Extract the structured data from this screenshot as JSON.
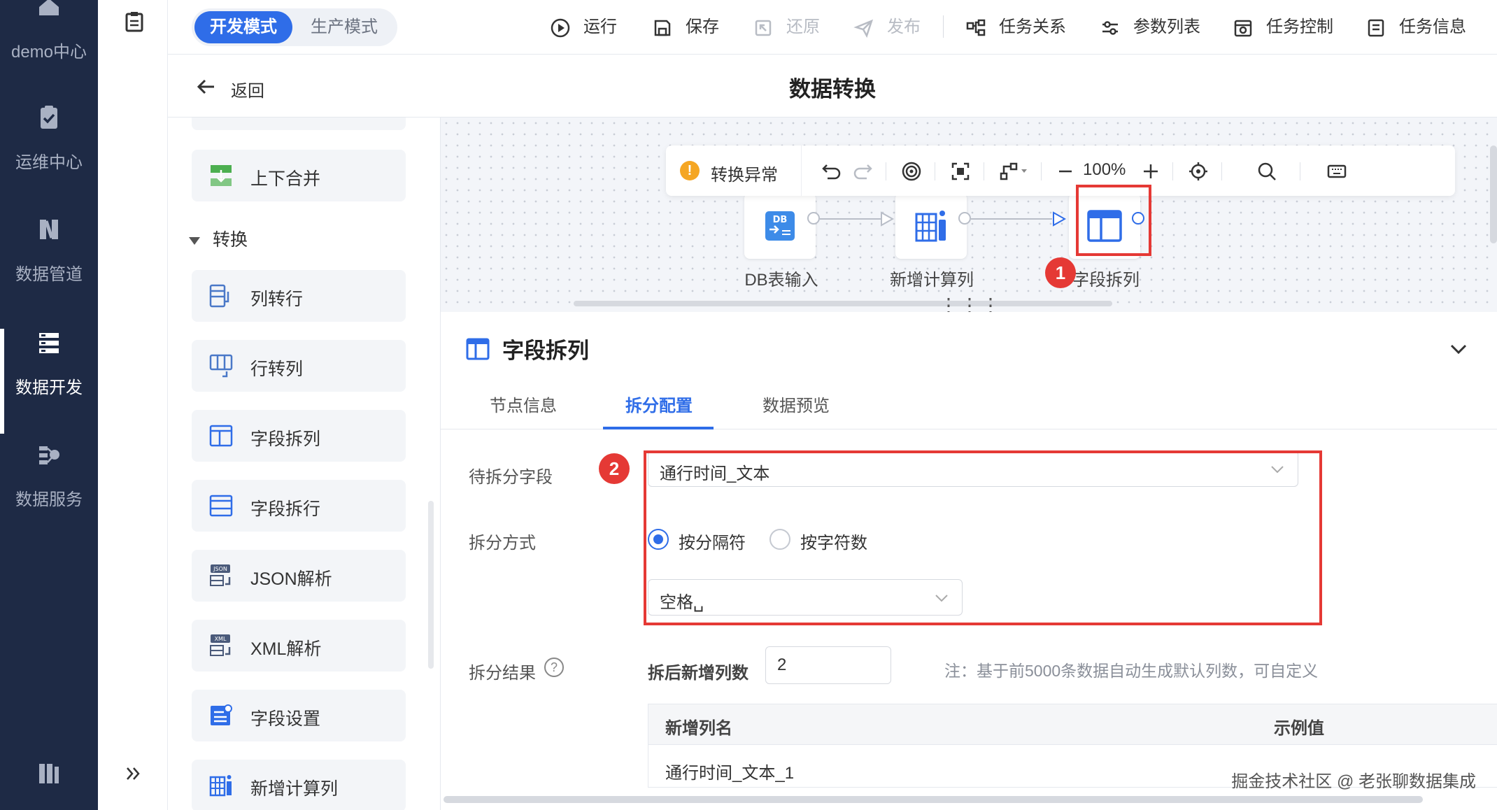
{
  "nav": {
    "items": [
      {
        "label": "demo中心",
        "icon": "home-icon"
      },
      {
        "label": "运维中心",
        "icon": "clipboard-check-icon"
      },
      {
        "label": "数据管道",
        "icon": "pipeline-icon"
      },
      {
        "label": "数据开发",
        "icon": "data-dev-icon",
        "active": true
      },
      {
        "label": "数据服务",
        "icon": "data-service-icon"
      }
    ],
    "bottom_icon": "book-icon",
    "expand_icon": "double-chevron-right-icon"
  },
  "header": {
    "mode_dev": "开发模式",
    "mode_prod": "生产模式",
    "actions": {
      "run": "运行",
      "save": "保存",
      "restore": "还原",
      "publish": "发布",
      "task_relation": "任务关系",
      "param_list": "参数列表",
      "task_control": "任务控制",
      "task_info": "任务信息"
    }
  },
  "titlebar": {
    "back": "返回",
    "title": "数据转换"
  },
  "components": {
    "top_item": "上下合并",
    "group_label": "转换",
    "items": [
      "列转行",
      "行转列",
      "字段拆列",
      "字段拆行",
      "JSON解析",
      "XML解析",
      "字段设置",
      "新增计算列"
    ]
  },
  "canvas": {
    "warning": "转换异常",
    "zoom": "100%",
    "nodes": [
      {
        "label": "DB表输入",
        "icon": "db-input-icon"
      },
      {
        "label": "新增计算列",
        "icon": "calc-column-icon"
      },
      {
        "label": "字段拆列",
        "icon": "split-column-icon"
      }
    ]
  },
  "config": {
    "title": "字段拆列",
    "tabs": [
      "节点信息",
      "拆分配置",
      "数据预览"
    ],
    "active_tab": "拆分配置",
    "field_label": "待拆分字段",
    "field_value": "通行时间_文本",
    "method_label": "拆分方式",
    "method_options": [
      "按分隔符",
      "按字符数"
    ],
    "method_selected": "按分隔符",
    "delimiter_value": "空格␣",
    "result_label": "拆分结果",
    "newcols_label": "拆后新增列数",
    "newcols_value": "2",
    "note": "注：基于前5000条数据自动生成默认列数，可自定义",
    "table": {
      "headers": [
        "新增列名",
        "示例值"
      ],
      "rows": [
        [
          "通行时间_文本_1",
          ""
        ]
      ]
    }
  },
  "annotations": {
    "badge1": "1",
    "badge2": "2"
  },
  "watermark": "掘金技术社区 @ 老张聊数据集成",
  "colors": {
    "accent": "#2f6de8",
    "nav_bg": "#1e2a45",
    "highlight": "#e53935",
    "warning": "#f5a623"
  }
}
